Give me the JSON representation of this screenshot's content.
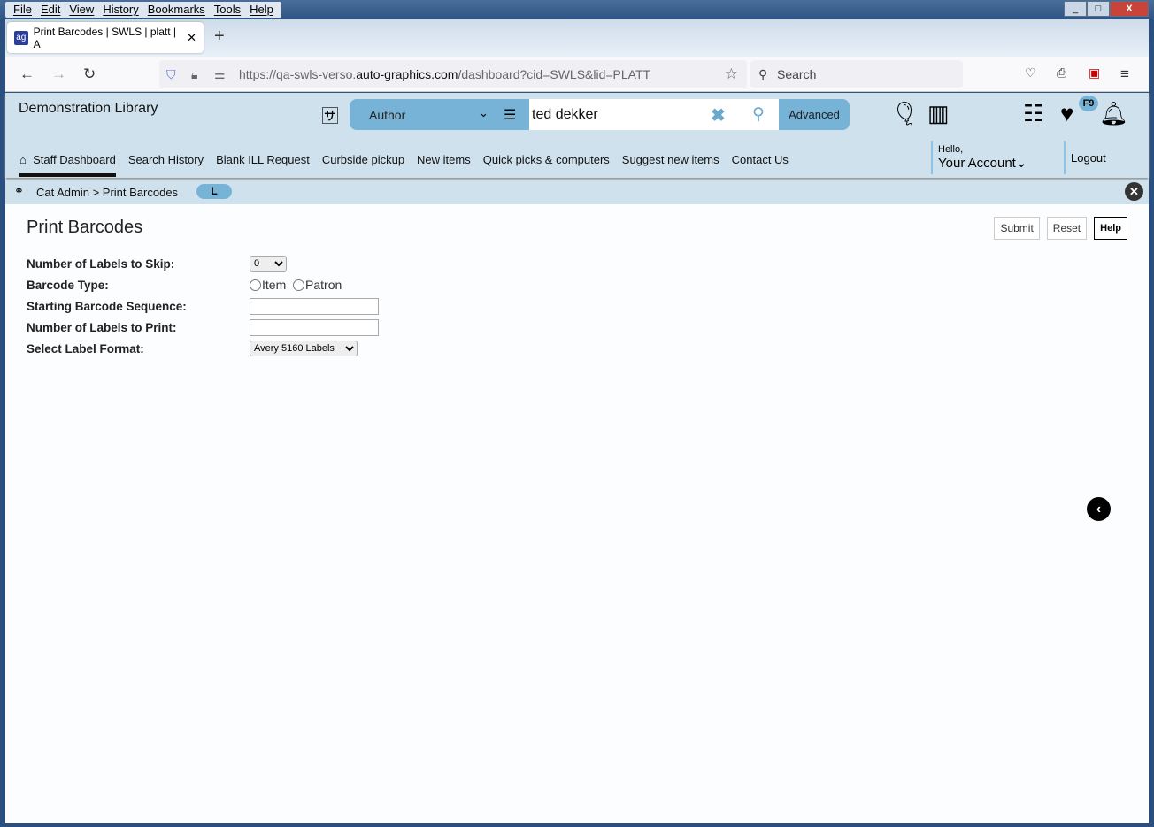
{
  "browser": {
    "menu": [
      "File",
      "Edit",
      "View",
      "History",
      "Bookmarks",
      "Tools",
      "Help"
    ],
    "tab_title": "Print Barcodes | SWLS | platt | A",
    "url_prefix": "https://qa-swls-verso.",
    "url_domain": "auto-graphics.com",
    "url_suffix": "/dashboard?cid=SWLS&lid=PLATT",
    "search_placeholder": "Search"
  },
  "header": {
    "library_name": "Demonstration Library",
    "search_type": "Author",
    "search_value": "ted dekker",
    "advanced_label": "Advanced",
    "badge": "F9",
    "nav": [
      "Staff Dashboard",
      "Search History",
      "Blank ILL Request",
      "Curbside pickup",
      "New items",
      "Quick picks & computers",
      "Suggest new items",
      "Contact Us"
    ],
    "hello": "Hello,",
    "account": "Your Account",
    "logout": "Logout"
  },
  "breadcrumb": {
    "text": "Cat Admin > Print Barcodes",
    "pill": "L"
  },
  "page": {
    "title": "Print Barcodes",
    "submit": "Submit",
    "reset": "Reset",
    "help": "Help",
    "fields": {
      "skip_label": "Number of Labels to Skip:",
      "skip_value": "0",
      "type_label": "Barcode Type:",
      "type_item": "Item",
      "type_patron": "Patron",
      "start_label": "Starting Barcode Sequence:",
      "start_value": "",
      "count_label": "Number of Labels to Print:",
      "count_value": "",
      "format_label": "Select Label Format:",
      "format_value": "Avery 5160 Labels"
    }
  },
  "colors": {
    "accent": "#76b3d6",
    "header_bg": "#cfe1ec"
  }
}
